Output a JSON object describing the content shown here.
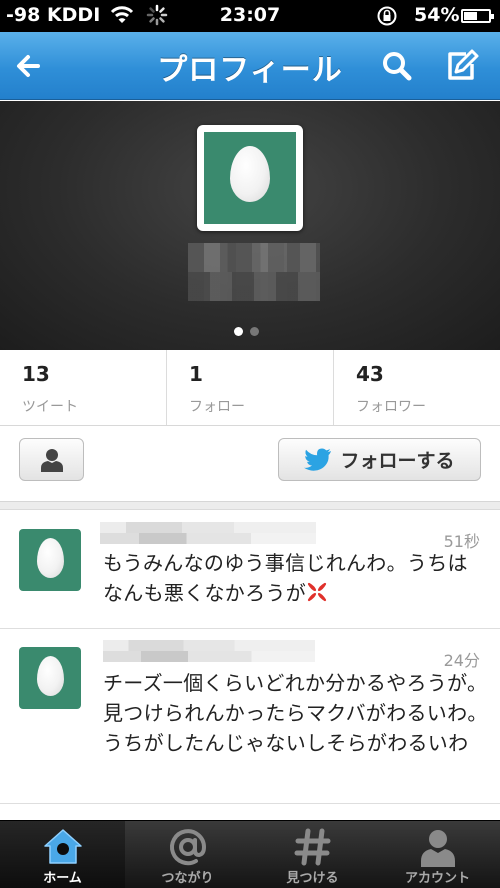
{
  "status_bar": {
    "carrier": "-98 KDDI",
    "time": "23:07",
    "battery_percent_text": "54%",
    "battery_level": 0.54
  },
  "nav_bar": {
    "title": "プロフィール",
    "back_icon": "arrow-left-icon",
    "search_icon": "search-icon",
    "compose_icon": "compose-icon"
  },
  "profile": {
    "avatar_color": "#3a8a6e",
    "page_indicator": {
      "count": 2,
      "active_index": 0
    }
  },
  "stats": [
    {
      "value": "13",
      "label": "ツイート"
    },
    {
      "value": "1",
      "label": "フォロー"
    },
    {
      "value": "43",
      "label": "フォロワー"
    }
  ],
  "actions": {
    "person_icon": "person-icon",
    "follow_label": "フォローする",
    "bird_icon": "twitter-bird-icon"
  },
  "tweets": [
    {
      "time": "51秒",
      "text": "もうみんなのゆう事信じれんわ。うちはなんも悪くなかろうが",
      "emoji": "anger-symbol-icon"
    },
    {
      "time": "24分",
      "text": "チーズ一個くらいどれか分かるやろうが。見つけられんかったらマクバがわるいわ。うちがしたんじゃないしそらがわるいわ"
    }
  ],
  "tab_bar": {
    "items": [
      {
        "label": "ホーム",
        "icon": "home-icon",
        "active": true
      },
      {
        "label": "つながり",
        "icon": "at-icon",
        "active": false
      },
      {
        "label": "見つける",
        "icon": "hashtag-icon",
        "active": false
      },
      {
        "label": "アカウント",
        "icon": "account-icon",
        "active": false
      }
    ]
  },
  "colors": {
    "nav_blue": "#2f8fd8",
    "egg_green": "#3a8a6e",
    "tab_active_blue": "#4aa8e8"
  }
}
